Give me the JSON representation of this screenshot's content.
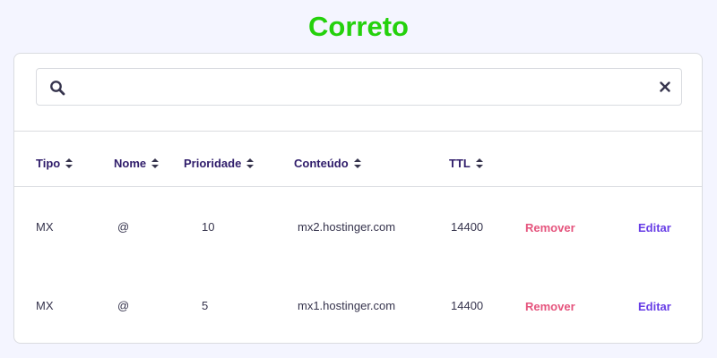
{
  "title": "Correto",
  "colors": {
    "title": "#24d10c",
    "remove": "#e5547d",
    "edit": "#673de6",
    "header_text": "#2f1c6a",
    "cell_text": "#36344d",
    "background": "#f4f5ff"
  },
  "search": {
    "placeholder": "",
    "value": "",
    "icon": "search-icon",
    "clear_icon": "close-icon"
  },
  "table": {
    "columns": [
      "Tipo",
      "Nome",
      "Prioridade",
      "Conteúdo",
      "TTL"
    ],
    "sort_icon": "sort-icon",
    "rows": [
      {
        "type": "MX",
        "name": "@",
        "priority": "10",
        "content": "mx2.hostinger.com",
        "ttl": "14400",
        "remove": "Remover",
        "edit": "Editar"
      },
      {
        "type": "MX",
        "name": "@",
        "priority": "5",
        "content": "mx1.hostinger.com",
        "ttl": "14400",
        "remove": "Remover",
        "edit": "Editar"
      }
    ]
  }
}
